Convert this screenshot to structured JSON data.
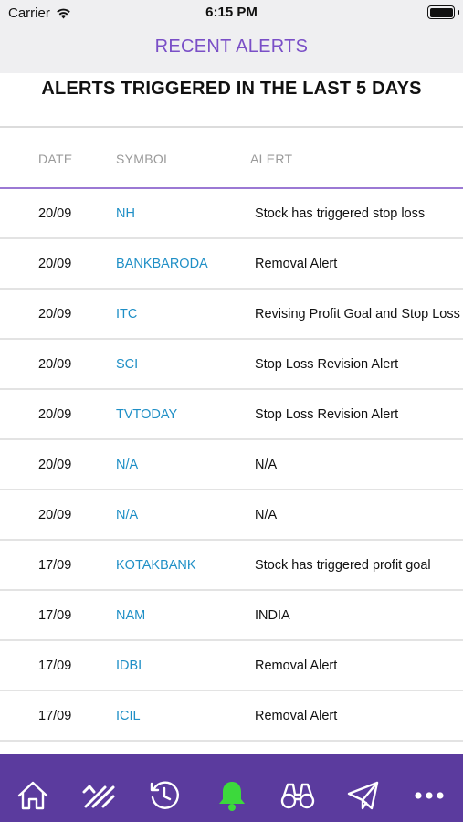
{
  "status_bar": {
    "carrier": "Carrier",
    "time": "6:15 PM"
  },
  "nav": {
    "title": "RECENT ALERTS"
  },
  "heading": "ALERTS TRIGGERED IN THE LAST 5 DAYS",
  "columns": {
    "date": "DATE",
    "symbol": "SYMBOL",
    "alert": "ALERT"
  },
  "alerts": [
    {
      "date": "20/09",
      "symbol": "NH",
      "alert": "Stock has triggered stop loss"
    },
    {
      "date": "20/09",
      "symbol": "BANKBARODA",
      "alert": "Removal Alert"
    },
    {
      "date": "20/09",
      "symbol": "ITC",
      "alert": "Revising Profit Goal and Stop Loss"
    },
    {
      "date": "20/09",
      "symbol": "SCI",
      "alert": "Stop Loss Revision Alert"
    },
    {
      "date": "20/09",
      "symbol": "TVTODAY",
      "alert": "Stop Loss Revision Alert"
    },
    {
      "date": "20/09",
      "symbol": "N/A",
      "alert": "N/A"
    },
    {
      "date": "20/09",
      "symbol": "N/A",
      "alert": "N/A"
    },
    {
      "date": "17/09",
      "symbol": "KOTAKBANK",
      "alert": "Stock has triggered profit goal"
    },
    {
      "date": "17/09",
      "symbol": "NAM",
      "alert": "INDIA"
    },
    {
      "date": "17/09",
      "symbol": "IDBI",
      "alert": "Removal Alert"
    },
    {
      "date": "17/09",
      "symbol": "ICIL",
      "alert": "Removal Alert"
    }
  ],
  "tab_bar": {
    "tabs": [
      {
        "icon": "home-icon",
        "active": false
      },
      {
        "icon": "trades-icon",
        "active": false
      },
      {
        "icon": "history-icon",
        "active": false
      },
      {
        "icon": "bell-icon",
        "active": true
      },
      {
        "icon": "binoculars-icon",
        "active": false
      },
      {
        "icon": "paper-plane-icon",
        "active": false
      },
      {
        "icon": "more-icon",
        "active": false
      }
    ]
  },
  "colors": {
    "accent": "#7a4fc7",
    "tab_bar": "#5b3b9e",
    "symbol_link": "#1f8fc6",
    "active_tab": "#3cd93c",
    "tab_icon": "#ffffff"
  }
}
